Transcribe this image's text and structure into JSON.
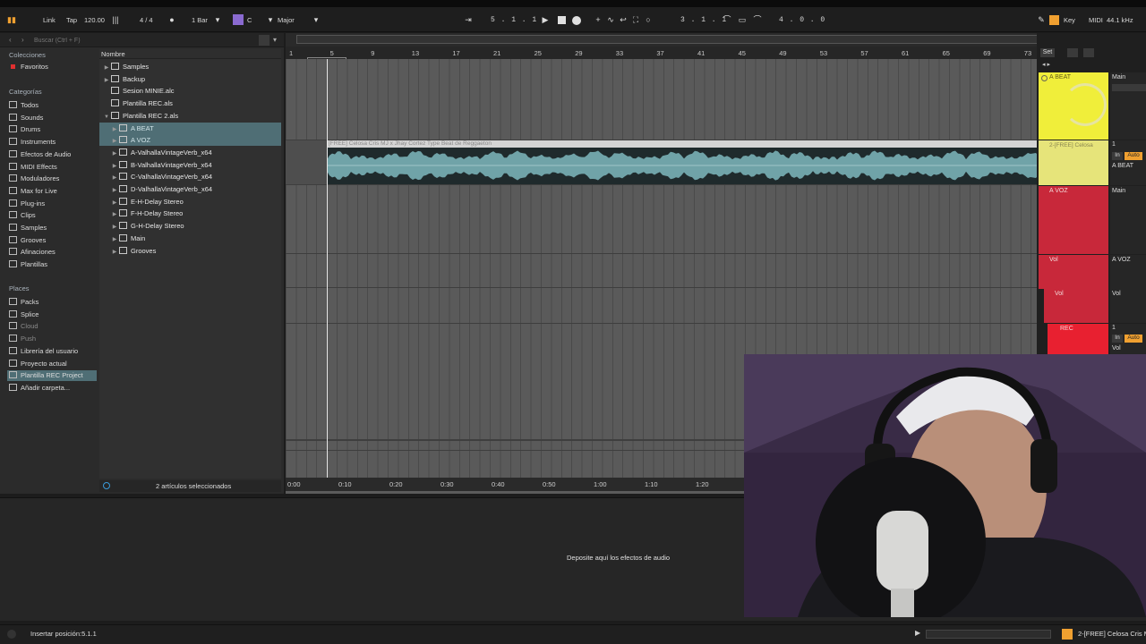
{
  "transport": {
    "link": "Link",
    "tap": "Tap",
    "tempo": "120.00",
    "signature": "4 / 4",
    "quantize": "1 Bar",
    "key_root": "C",
    "scale": "Major",
    "position": "5 .  1 .  1",
    "loop_start": "3 .  1 .  1",
    "loop_length": "4 .  0 .  0",
    "key_label": "Key",
    "midi_label": "MIDI",
    "sample_rate": "44.1 kHz"
  },
  "browser": {
    "search_placeholder": "Buscar (Ctrl + F)",
    "collections_title": "Colecciones",
    "favorites": "Favoritos",
    "categories_title": "Categorías",
    "categories": [
      "Todos",
      "Sounds",
      "Drums",
      "Instruments",
      "Efectos de Audio",
      "MIDI Effects",
      "Moduladores",
      "Max for Live",
      "Plug-ins",
      "Clips",
      "Samples",
      "Grooves",
      "Afinaciones",
      "Plantillas"
    ],
    "places_title": "Places",
    "places": [
      "Packs",
      "Splice",
      "Cloud",
      "Push",
      "Librería del usuario",
      "Proyecto actual",
      "Plantilla REC Project",
      "Añadir carpeta..."
    ],
    "column_header": "Nombre",
    "files": [
      {
        "name": "Samples",
        "level": 0,
        "arrow": "▶",
        "selected": false
      },
      {
        "name": "Backup",
        "level": 0,
        "arrow": "▶",
        "selected": false
      },
      {
        "name": "Sesion MINIE.alc",
        "level": 0,
        "arrow": "",
        "selected": false
      },
      {
        "name": "Plantilla REC.als",
        "level": 0,
        "arrow": "",
        "selected": false
      },
      {
        "name": "Plantilla REC 2.als",
        "level": 0,
        "arrow": "▼",
        "selected": false
      },
      {
        "name": "A BEAT",
        "level": 1,
        "arrow": "▶",
        "selected": true
      },
      {
        "name": "A VOZ",
        "level": 1,
        "arrow": "▶",
        "selected": true
      },
      {
        "name": "A-ValhallaVintageVerb_x64",
        "level": 1,
        "arrow": "▶",
        "selected": false
      },
      {
        "name": "B-ValhallaVintageVerb_x64",
        "level": 1,
        "arrow": "▶",
        "selected": false
      },
      {
        "name": "C-ValhallaVintageVerb_x64",
        "level": 1,
        "arrow": "▶",
        "selected": false
      },
      {
        "name": "D-ValhallaVintageVerb_x64",
        "level": 1,
        "arrow": "▶",
        "selected": false
      },
      {
        "name": "E-H-Delay Stereo",
        "level": 1,
        "arrow": "▶",
        "selected": false
      },
      {
        "name": "F-H-Delay Stereo",
        "level": 1,
        "arrow": "▶",
        "selected": false
      },
      {
        "name": "G-H-Delay Stereo",
        "level": 1,
        "arrow": "▶",
        "selected": false
      },
      {
        "name": "Main",
        "level": 1,
        "arrow": "▶",
        "selected": false
      },
      {
        "name": "Grooves",
        "level": 1,
        "arrow": "▶",
        "selected": false
      }
    ],
    "footer": "2 artículos seleccionados"
  },
  "arrangement": {
    "bar_numbers": [
      "1",
      "5",
      "9",
      "13",
      "17",
      "21",
      "25",
      "29",
      "33",
      "37",
      "41",
      "45",
      "49",
      "53",
      "57",
      "61",
      "65",
      "69",
      "73"
    ],
    "time_labels": [
      "0:00",
      "0:10",
      "0:20",
      "0:30",
      "0:40",
      "0:50",
      "1:00",
      "1:10",
      "1:20"
    ],
    "clip_name": "[FREE] Celosa Cris MJ x Jhay Cortez Type Beat de Reggaeton"
  },
  "mixer": {
    "set_label": "Set",
    "tracks": [
      {
        "name": "A BEAT",
        "io": "Main",
        "color": "#f0ee3a"
      },
      {
        "name": "2-[FREE] Celosa",
        "io": "A BEAT",
        "color": "#e8e67a"
      },
      {
        "name": "A VOZ",
        "io": "Main",
        "color": "#c8283a"
      },
      {
        "name": "Vol",
        "io": "A VOZ",
        "color": "#c8283a"
      },
      {
        "name": "Vol",
        "io": "Vol",
        "color": "#c8283a"
      },
      {
        "name": "REC",
        "io": "Vol",
        "color": "#e82030"
      }
    ],
    "in_label": "In",
    "auto_label": "Auto",
    "track_num": "1"
  },
  "devices": {
    "drop_message": "Deposite aquí los efectos de audio"
  },
  "status": {
    "left_text": "Insertar posición:5.1.1",
    "right_clip": "2-[FREE] Celosa Cris M"
  }
}
